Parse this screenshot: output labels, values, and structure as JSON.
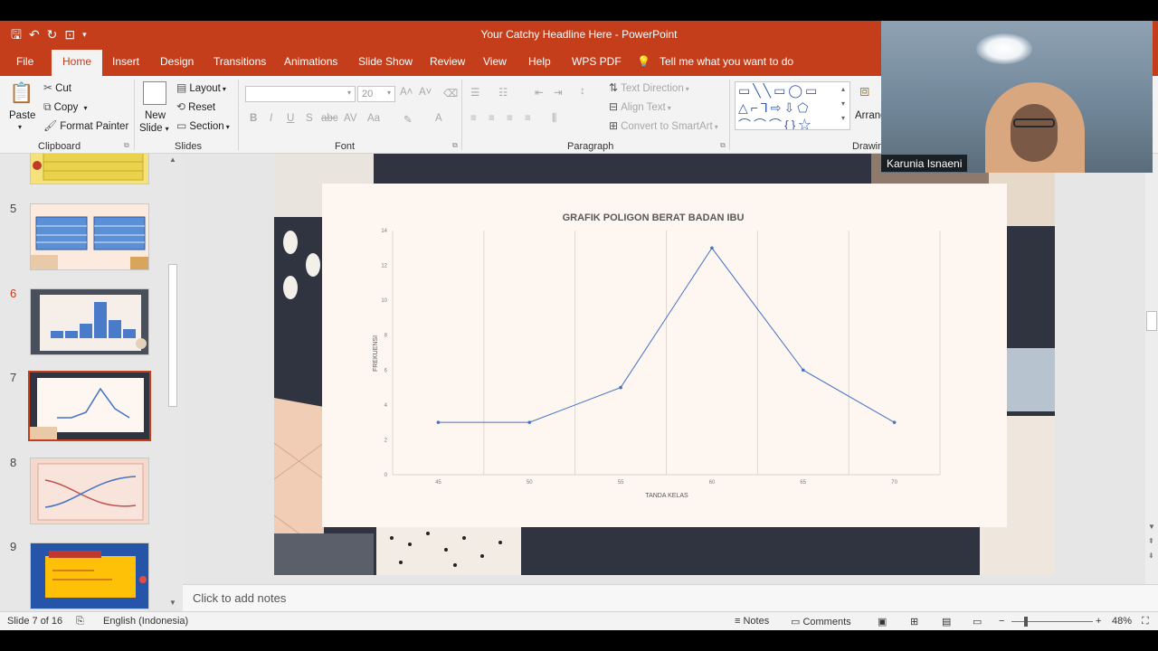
{
  "window": {
    "title": "Your Catchy Headline Here  -  PowerPoint",
    "tabs": [
      "File",
      "Home",
      "Insert",
      "Design",
      "Transitions",
      "Animations",
      "Slide Show",
      "Review",
      "View",
      "Help",
      "WPS PDF"
    ],
    "tell_me": "Tell me what you want to do"
  },
  "ribbon": {
    "clipboard": {
      "paste": "Paste",
      "cut": "Cut",
      "copy": "Copy",
      "format_painter": "Format Painter",
      "label": "Clipboard"
    },
    "slides": {
      "new_slide_1": "New",
      "new_slide_2": "Slide",
      "layout": "Layout",
      "reset": "Reset",
      "section": "Section",
      "label": "Slides"
    },
    "font": {
      "size": "20",
      "label": "Font"
    },
    "paragraph": {
      "text_direction": "Text Direction",
      "align_text": "Align Text",
      "convert_smartart": "Convert to SmartArt",
      "label": "Paragraph"
    },
    "drawing": {
      "arrange": "Arrang",
      "label": "Drawin"
    }
  },
  "thumbnails": [
    {
      "num": "5"
    },
    {
      "num": "6"
    },
    {
      "num": "7"
    },
    {
      "num": "8"
    },
    {
      "num": "9"
    }
  ],
  "chart_data": {
    "type": "line",
    "title": "GRAFIK POLIGON BERAT BADAN IBU",
    "xlabel": "TANDA KELAS",
    "ylabel": "FREKUENSI",
    "categories": [
      "45",
      "50",
      "55",
      "60",
      "65",
      "70"
    ],
    "values": [
      3,
      3,
      5,
      13,
      6,
      3
    ],
    "yticks": [
      "0",
      "2",
      "4",
      "6",
      "8",
      "10",
      "12",
      "14"
    ],
    "ylim": [
      0,
      14
    ],
    "line_color": "#4472c4",
    "grid": "vertical"
  },
  "notes": {
    "placeholder": "Click to add notes"
  },
  "status": {
    "slide": "Slide 7 of 16",
    "language": "English (Indonesia)",
    "notes": "Notes",
    "comments": "Comments",
    "zoom": "48%"
  },
  "webcam": {
    "name": "Karunia Isnaeni"
  }
}
